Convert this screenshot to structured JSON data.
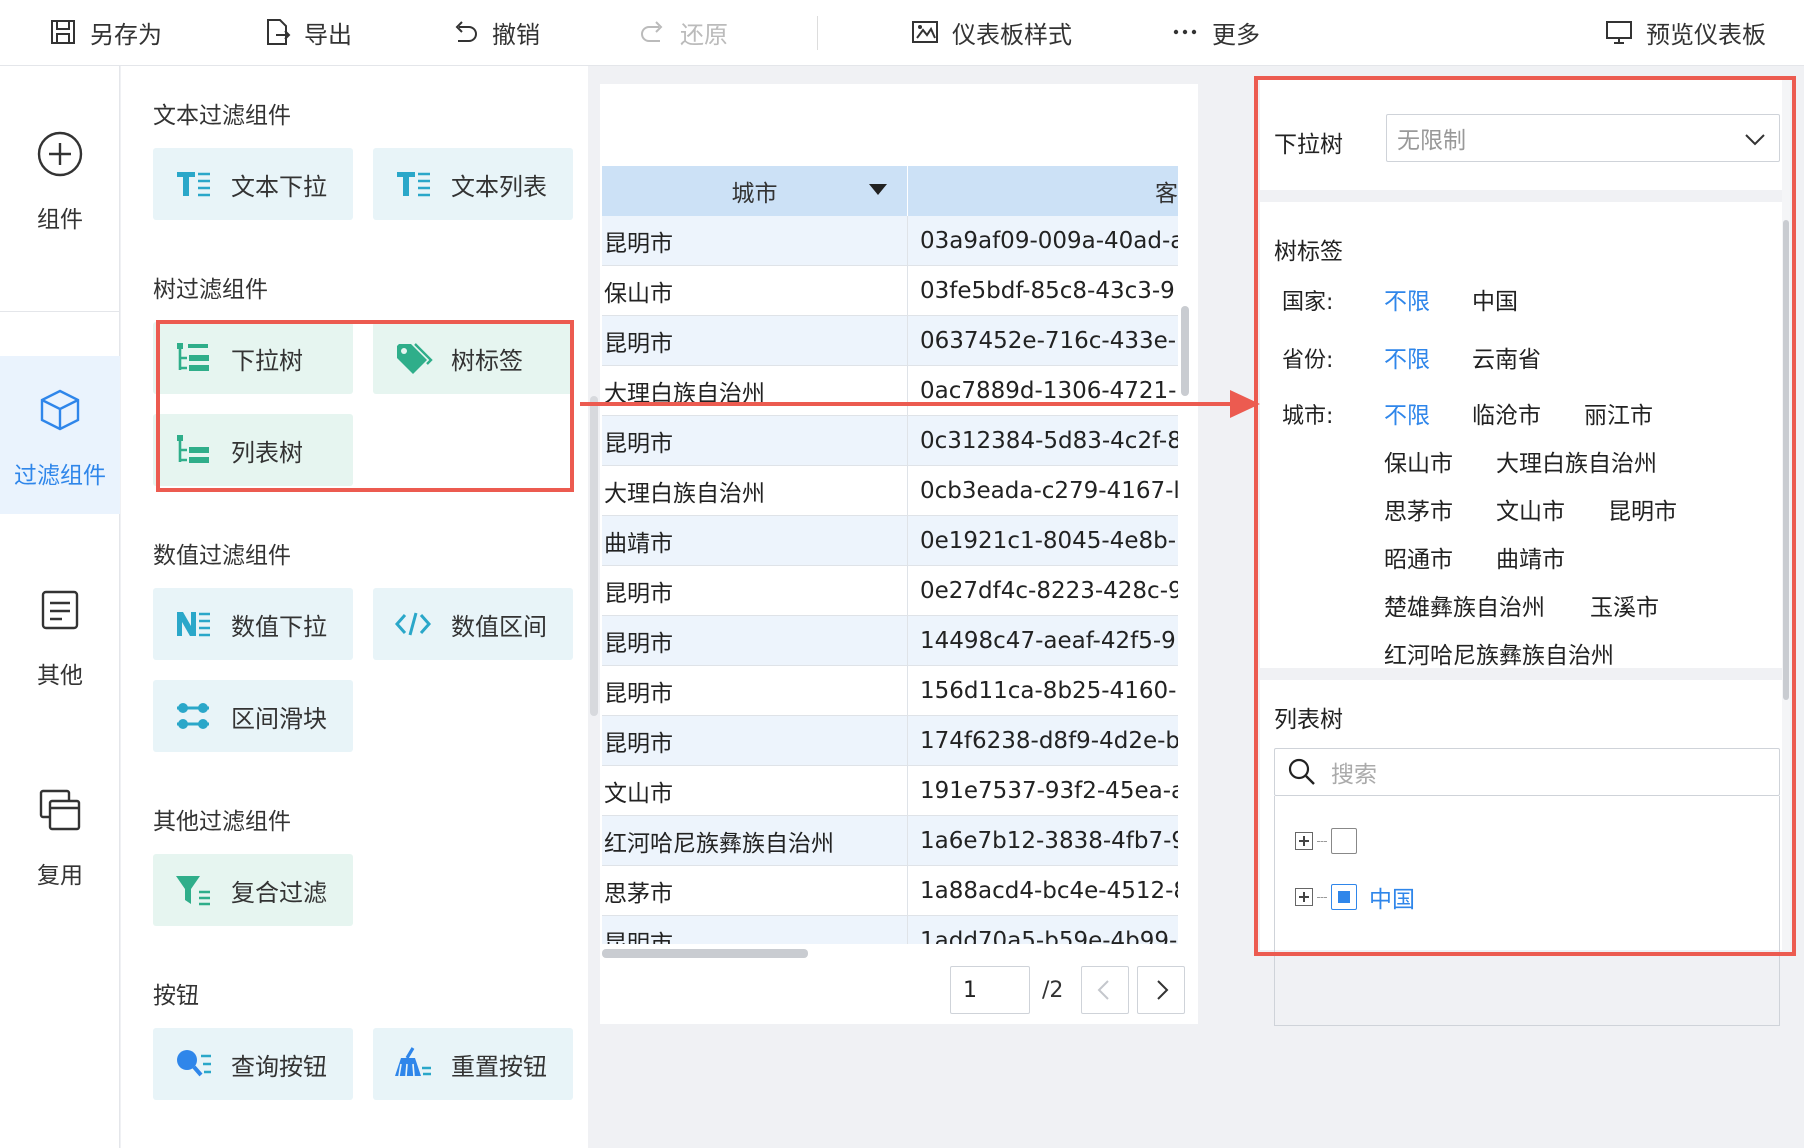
{
  "toolbar": {
    "save_as": "另存为",
    "export": "导出",
    "undo": "撤销",
    "redo": "还原",
    "dashboard_style": "仪表板样式",
    "more": "更多",
    "preview": "预览仪表板"
  },
  "rail": {
    "components": "组件",
    "filter_components": "过滤组件",
    "other": "其他",
    "reuse": "复用"
  },
  "panel": {
    "text_filter": {
      "title": "文本过滤组件",
      "items": [
        "文本下拉",
        "文本列表"
      ]
    },
    "tree_filter": {
      "title": "树过滤组件",
      "items": [
        "下拉树",
        "树标签",
        "列表树"
      ]
    },
    "number_filter": {
      "title": "数值过滤组件",
      "items": [
        "数值下拉",
        "数值区间",
        "区间滑块"
      ]
    },
    "other_filter": {
      "title": "其他过滤组件",
      "items": [
        "复合过滤"
      ]
    },
    "buttons": {
      "title": "按钮",
      "items": [
        "查询按钮",
        "重置按钮"
      ]
    }
  },
  "table": {
    "column_city": "城市",
    "column_id_partial": "客",
    "rows": [
      [
        "昆明市",
        "03a9af09-009a-40ad-a"
      ],
      [
        "保山市",
        "03fe5bdf-85c8-43c3-9"
      ],
      [
        "昆明市",
        "0637452e-716c-433e-l"
      ],
      [
        "大理白族自治州",
        "0ac7889d-1306-4721-"
      ],
      [
        "昆明市",
        "0c312384-5d83-4c2f-8"
      ],
      [
        "大理白族自治州",
        "0cb3eada-c279-4167-l"
      ],
      [
        "曲靖市",
        "0e1921c1-8045-4e8b-"
      ],
      [
        "昆明市",
        "0e27df4c-8223-428c-9"
      ],
      [
        "昆明市",
        "14498c47-aeaf-42f5-9"
      ],
      [
        "昆明市",
        "156d11ca-8b25-4160-"
      ],
      [
        "昆明市",
        "174f6238-d8f9-4d2e-b"
      ],
      [
        "文山市",
        "191e7537-93f2-45ea-a"
      ],
      [
        "红河哈尼族彝族自治州",
        "1a6e7b12-3838-4fb7-9"
      ],
      [
        "思茅市",
        "1a88acd4-bc4e-4512-8"
      ],
      [
        "昆明市",
        "1add70a5-b59e-4b99-"
      ]
    ],
    "pager": {
      "current_page": "1",
      "total": "/2"
    }
  },
  "preview": {
    "dropdown_tree": {
      "label": "下拉树",
      "placeholder": "无限制"
    },
    "tree_tags": {
      "label": "树标签",
      "country_label": "国家:",
      "country_tags": [
        "不限",
        "中国"
      ],
      "province_label": "省份:",
      "province_tags": [
        "不限",
        "云南省"
      ],
      "city_label": "城市:",
      "city_tags": [
        "不限",
        "临沧市",
        "丽江市",
        "保山市",
        "大理白族自治州",
        "思茅市",
        "文山市",
        "昆明市",
        "昭通市",
        "曲靖市",
        "楚雄彝族自治州",
        "玉溪市",
        "红河哈尼族彝族自治州"
      ]
    },
    "list_tree": {
      "label": "列表树",
      "search_placeholder": "搜索",
      "node_empty": "",
      "node_china": "中国"
    }
  },
  "colors": {
    "accent": "#2f86ea",
    "highlight_box": "#ec5b50",
    "table_header": "#cce1f6",
    "text_component_bg": "#e8f4f8",
    "tree_component_bg": "#e6f5f0"
  }
}
